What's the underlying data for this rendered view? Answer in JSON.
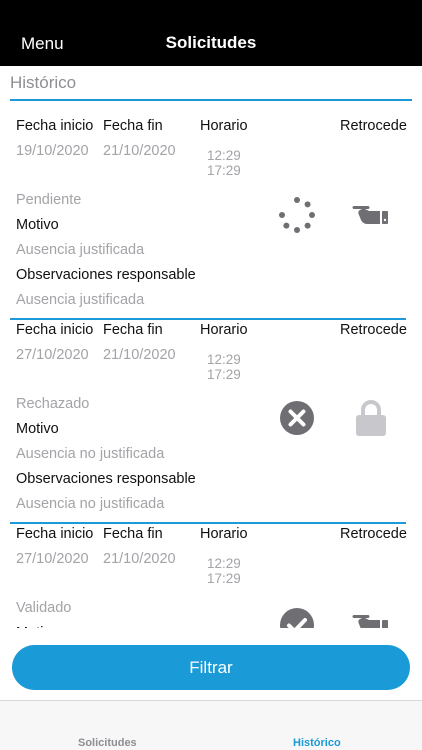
{
  "navbar": {
    "menu_label": "Menu",
    "title": "Solicitudes"
  },
  "section": {
    "title": "Histórico"
  },
  "labels": {
    "start": "Fecha inicio",
    "end": "Fecha fin",
    "schedule": "Horario",
    "back": "Retrocede",
    "reason": "Motivo",
    "observations": "Observaciones responsable"
  },
  "requests": [
    {
      "start": "19/10/2020",
      "end": "21/10/2020",
      "time_from": "12:29",
      "time_to": "17:29",
      "status": "Pendiente",
      "reason": "Ausencia justificada",
      "observations": "Ausencia justificada",
      "status_icon": "spinner-icon",
      "action_icon": "hand-pointing-icon"
    },
    {
      "start": "27/10/2020",
      "end": "21/10/2020",
      "time_from": "12:29",
      "time_to": "17:29",
      "status": "Rechazado",
      "reason": "Ausencia no justificada",
      "observations": "Ausencia no justificada",
      "status_icon": "x-circle-icon",
      "action_icon": "lock-icon"
    },
    {
      "start": "27/10/2020",
      "end": "21/10/2020",
      "time_from": "12:29",
      "time_to": "17:29",
      "status": "Validado",
      "reason": "",
      "observations": "",
      "status_icon": "check-circle-icon",
      "action_icon": "hand-pointing-icon"
    }
  ],
  "filter_button": "Filtrar",
  "tabs": [
    {
      "label": "Solicitudes",
      "active": false
    },
    {
      "label": "Histórico",
      "active": true
    }
  ],
  "colors": {
    "accent": "#1a9ad6",
    "muted": "#a3a3a8",
    "icon_dark": "#6e6e73",
    "icon_light": "#c7c7cc",
    "navbar": "#000000"
  }
}
